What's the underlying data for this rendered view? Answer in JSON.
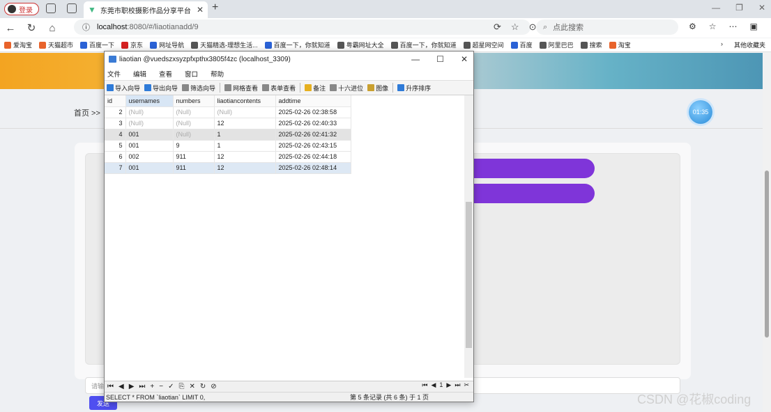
{
  "browser": {
    "login_label": "登录",
    "tab_title": "东莞市职校摄影作品分享平台",
    "url_host": "localhost",
    "url_path": ":8080/#/liaotianadd/9",
    "search_placeholder": "点此搜索",
    "bookmarks": [
      "爱淘宝",
      "天猫超市",
      "百度一下",
      "京东",
      "网址导航",
      "天猫精选-理想生活...",
      "百度一下，你就知道",
      "粤霸网址大全",
      "百度一下，你就知道",
      "超星网空间",
      "百度",
      "阿里巴巴",
      "搜索",
      "淘宝"
    ],
    "other_bookmarks": "其他收藏夹"
  },
  "page": {
    "breadcrumb": "首页 >>",
    "clock": "01:35",
    "input_placeholder": "请输",
    "send_label": "发送",
    "watermark": "CSDN @花椒coding"
  },
  "navicat": {
    "title": "liaotian @vuedszxsyzpfxpthx3805f4zc (localhost_3309)",
    "menu": [
      "文件",
      "编辑",
      "查看",
      "窗口",
      "帮助"
    ],
    "toolbar": [
      "导入向导",
      "导出向导",
      "筛选向导",
      "网格查看",
      "表单查看",
      "备注",
      "十六进位",
      "图像",
      "升序排序"
    ],
    "columns": [
      "id",
      "usernames",
      "numbers",
      "liaotiancontents",
      "addtime"
    ],
    "rows": [
      [
        "2",
        "(Null)",
        "(Null)",
        "(Null)",
        "2025-02-26 02:38:58"
      ],
      [
        "3",
        "(Null)",
        "(Null)",
        "12",
        "2025-02-26 02:40:33"
      ],
      [
        "4",
        "001",
        "(Null)",
        "1",
        "2025-02-26 02:41:32"
      ],
      [
        "5",
        "001",
        "9",
        "1",
        "2025-02-26 02:43:15"
      ],
      [
        "6",
        "002",
        "911",
        "12",
        "2025-02-26 02:44:18"
      ],
      [
        "7",
        "001",
        "911",
        "12",
        "2025-02-26 02:48:14"
      ]
    ],
    "sql": "SELECT * FROM `liaotian` LIMIT 0,",
    "record_status": "第 5 条记录 (共 6 条) 于 1 页",
    "page_num": "1"
  }
}
